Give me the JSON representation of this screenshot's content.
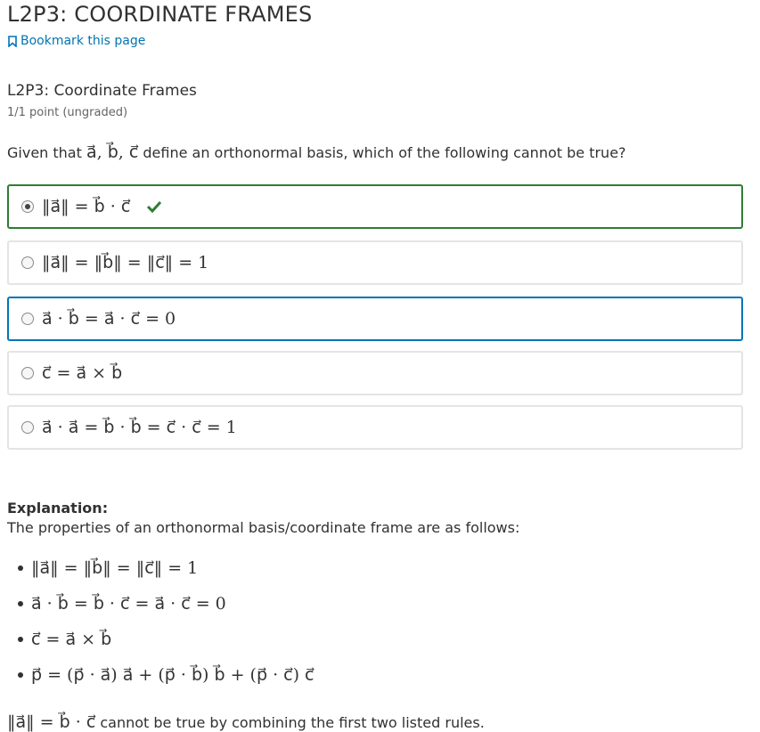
{
  "page": {
    "title": "L2P3: COORDINATE FRAMES",
    "bookmark_label": "Bookmark this page"
  },
  "problem": {
    "title": "L2P3: Coordinate Frames",
    "points": "1/1 point (ungraded)",
    "question_pre": "Given that ",
    "question_vars": "a⃗, b⃗, c⃗",
    "question_post": " define an orthonormal basis, which of the following cannot be true?",
    "choices": [
      {
        "label": "‖a⃗‖ = b⃗ · c⃗",
        "selected": true,
        "status": "correct"
      },
      {
        "label": "‖a⃗‖ = ‖b⃗‖ = ‖c⃗‖ = 1",
        "selected": false
      },
      {
        "label": "a⃗ · b⃗ = a⃗ · c⃗ = 0",
        "selected": false
      },
      {
        "label": "c⃗ = a⃗ × b⃗",
        "selected": false
      },
      {
        "label": "a⃗ · a⃗ = b⃗ · b⃗ = c⃗ · c⃗ = 1",
        "selected": false
      }
    ]
  },
  "explanation": {
    "label": "Explanation:",
    "intro": "The properties of an orthonormal basis/coordinate frame are as follows:",
    "rules": [
      "‖a⃗‖ = ‖b⃗‖ = ‖c⃗‖ = 1",
      "a⃗ · b⃗ = b⃗ · c⃗ = a⃗ · c⃗ = 0",
      "c⃗ = a⃗ × b⃗",
      "p⃗ = (p⃗ · a⃗) a⃗ + (p⃗ · b⃗) b⃗ + (p⃗ · c⃗) c⃗"
    ],
    "conclusion_math": "‖a⃗‖ = b⃗ · c⃗",
    "conclusion_text": " cannot be true by combining the first two listed rules."
  },
  "colors": {
    "link": "#0075b4",
    "correct_border": "#2e7d32",
    "focus_border": "#0075b4",
    "check": "#2e7d32"
  },
  "icons": {
    "bookmark": "bookmark-icon",
    "correct": "checkmark-icon"
  }
}
